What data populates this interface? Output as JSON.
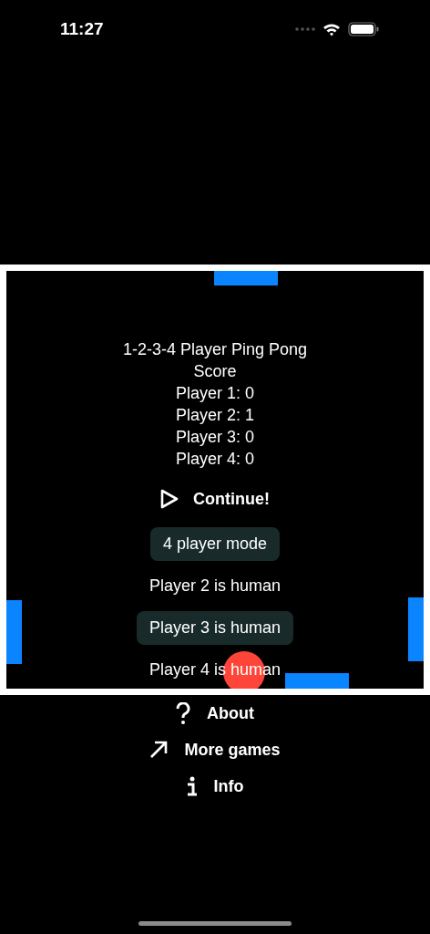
{
  "status_bar": {
    "time": "11:27"
  },
  "game": {
    "title": "1-2-3-4 Player Ping Pong",
    "score_heading": "Score",
    "scores": [
      "Player 1: 0",
      "Player 2: 1",
      "Player 3: 0",
      "Player 4: 0"
    ],
    "continue_button": "Continue!",
    "toggles": [
      {
        "label": "4 player mode",
        "selected": true
      },
      {
        "label": "Player 2 is human",
        "selected": false
      },
      {
        "label": "Player 3 is human",
        "selected": true
      },
      {
        "label": "Player 4 is human",
        "selected": false
      }
    ]
  },
  "menu": [
    {
      "kind": "about",
      "label": "About"
    },
    {
      "kind": "more",
      "label": "More games"
    },
    {
      "kind": "info",
      "label": "Info"
    }
  ]
}
